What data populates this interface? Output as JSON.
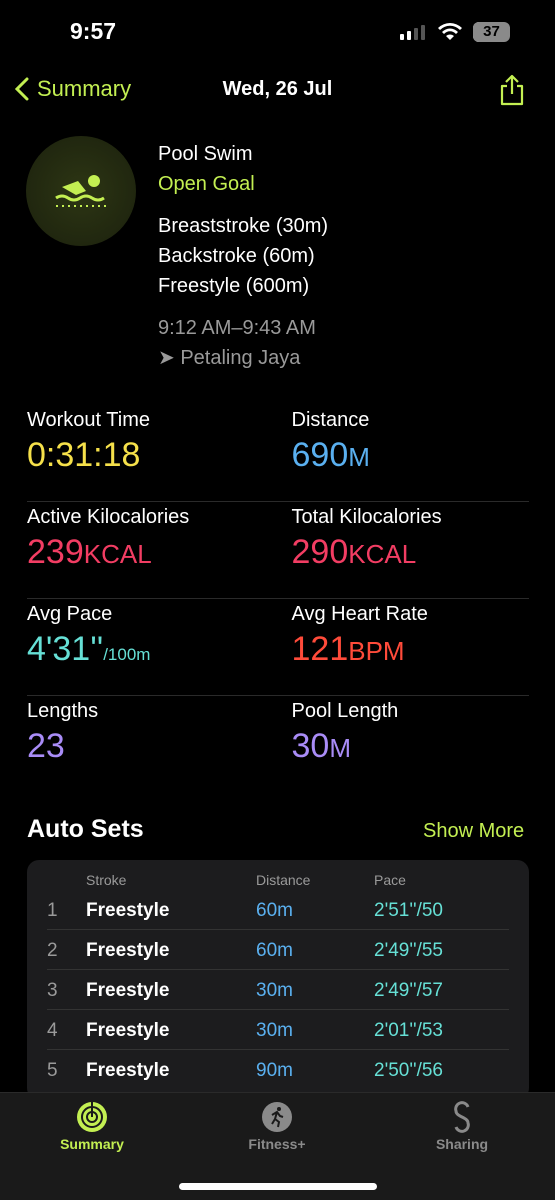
{
  "status": {
    "time": "9:57",
    "battery": "37"
  },
  "nav": {
    "back_label": "Summary",
    "title": "Wed, 26 Jul"
  },
  "workout": {
    "type": "Pool Swim",
    "goal": "Open Goal",
    "strokes": [
      "Breaststroke (30m)",
      "Backstroke (60m)",
      "Freestyle (600m)"
    ],
    "time_range": "9:12 AM–9:43 AM",
    "location": "Petaling Jaya"
  },
  "metrics": [
    {
      "label": "Workout Time",
      "value": "0:31:18",
      "unit": "",
      "color": "#f5e04a"
    },
    {
      "label": "Distance",
      "value": "690",
      "unit": "M",
      "color": "#5ab0f0"
    },
    {
      "label": "Active Kilocalories",
      "value": "239",
      "unit": "KCAL",
      "color": "#f23d63"
    },
    {
      "label": "Total Kilocalories",
      "value": "290",
      "unit": "KCAL",
      "color": "#f23d63"
    },
    {
      "label": "Avg Pace",
      "value": "4'31''",
      "unit": "/100m",
      "color": "#66e0d6"
    },
    {
      "label": "Avg Heart Rate",
      "value": "121",
      "unit": "BPM",
      "color": "#ff4b3a"
    },
    {
      "label": "Lengths",
      "value": "23",
      "unit": "",
      "color": "#a98cf7"
    },
    {
      "label": "Pool Length",
      "value": "30",
      "unit": "M",
      "color": "#a98cf7"
    }
  ],
  "auto_sets": {
    "title": "Auto Sets",
    "show_more": "Show More",
    "headers": [
      "Stroke",
      "Distance",
      "Pace"
    ],
    "rows": [
      {
        "n": "1",
        "stroke": "Freestyle",
        "distance": "60m",
        "pace": "2'51''/50"
      },
      {
        "n": "2",
        "stroke": "Freestyle",
        "distance": "60m",
        "pace": "2'49''/55"
      },
      {
        "n": "3",
        "stroke": "Freestyle",
        "distance": "30m",
        "pace": "2'49''/57"
      },
      {
        "n": "4",
        "stroke": "Freestyle",
        "distance": "30m",
        "pace": "2'01''/53"
      },
      {
        "n": "5",
        "stroke": "Freestyle",
        "distance": "90m",
        "pace": "2'50''/56"
      }
    ]
  },
  "tabs": [
    {
      "label": "Summary",
      "active": true
    },
    {
      "label": "Fitness+"
    },
    {
      "label": "Sharing"
    }
  ],
  "colors": {
    "accent": "#c3ef52",
    "distance": "#5ab0f0",
    "pace": "#66e0d6"
  }
}
